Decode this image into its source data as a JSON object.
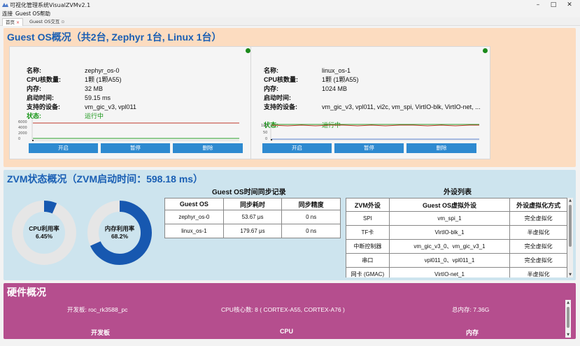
{
  "window": {
    "title": "可视化管理系统VisualZVMv2.1"
  },
  "menu": [
    "连接",
    "Guest OS",
    "帮助"
  ],
  "tabs": [
    {
      "label": "首页",
      "close": "×"
    },
    {
      "label": "Guest OS交互",
      "close": "⊙"
    }
  ],
  "guest_section": {
    "title": "Guest OS概况（共2台, Zephyr 1台, Linux 1台）",
    "field_labels": {
      "name": "名称:",
      "cpu": "CPU核数量:",
      "memory": "内存:",
      "boot_time": "启动时间:",
      "devices": "支持的设备:",
      "status": "状态:"
    },
    "buttons": {
      "start": "开启",
      "pause": "暂停",
      "delete": "删除"
    },
    "cards": [
      {
        "name": "zephyr_os-0",
        "cpu": "1颗 (1颗A55)",
        "memory": "32 MB",
        "boot_time": "59.15 ms",
        "devices": "vm_gic_v3, vpl011",
        "status": "运行中",
        "chart_ticks": [
          "6000",
          "4000",
          "2000",
          "0"
        ]
      },
      {
        "name": "linux_os-1",
        "cpu": "1颗 (1颗A55)",
        "memory": "1024 MB",
        "boot_time": "",
        "devices": "vm_gic_v3, vpl011, vi2c, vm_spi, VirtIO-blk, VirtIO-net, ...",
        "status": "运行中",
        "chart_ticks": [
          "100",
          "50",
          "0"
        ]
      }
    ]
  },
  "zvm_section": {
    "title": "ZVM状态概况（ZVM启动时间：598.18 ms）",
    "cpu_usage": {
      "label": "CPU利用率",
      "value": "6.45%",
      "fraction": 0.0645
    },
    "mem_usage": {
      "label": "内存利用率",
      "value": "68.2%",
      "fraction": 0.682
    },
    "sync_table": {
      "title": "Guest OS时间同步记录",
      "headers": [
        "Guest OS",
        "同步耗时",
        "同步精度"
      ],
      "rows": [
        [
          "zephyr_os-0",
          "53.67 μs",
          "0 ns"
        ],
        [
          "linux_os-1",
          "179.67 μs",
          "0 ns"
        ]
      ]
    },
    "device_table": {
      "title": "外设列表",
      "headers": [
        "ZVM外设",
        "Guest OS虚拟外设",
        "外设虚拟化方式"
      ],
      "rows": [
        [
          "SPI",
          "vm_spi_1",
          "完全虚拟化"
        ],
        [
          "TF卡",
          "VirtIO-blk_1",
          "半虚拟化"
        ],
        [
          "中断控制器",
          "vm_gic_v3_0、vm_gic_v3_1",
          "完全虚拟化"
        ],
        [
          "串口",
          "vpl011_0、vpl011_1",
          "完全虚拟化"
        ],
        [
          "网卡 (GMAC)",
          "VirtIO-net_1",
          "半虚拟化"
        ]
      ]
    }
  },
  "hw_section": {
    "title": "硬件概况",
    "board": "开发板: roc_rk3588_pc",
    "cpu_cores": "CPU核心数: 8 ( CORTEX-A55, CORTEX-A76 )",
    "memory": "总内存: 7.36G",
    "columns": [
      "开发板",
      "CPU",
      "内存"
    ]
  },
  "colors": {
    "accent": "#1a5fb4",
    "button": "#2e8ad0",
    "running": "#179617",
    "guest_bg": "#fcdcc0",
    "zvm_bg": "#cde4ee",
    "hw_bg": "#b54e8e",
    "donut": "#1758b0"
  }
}
